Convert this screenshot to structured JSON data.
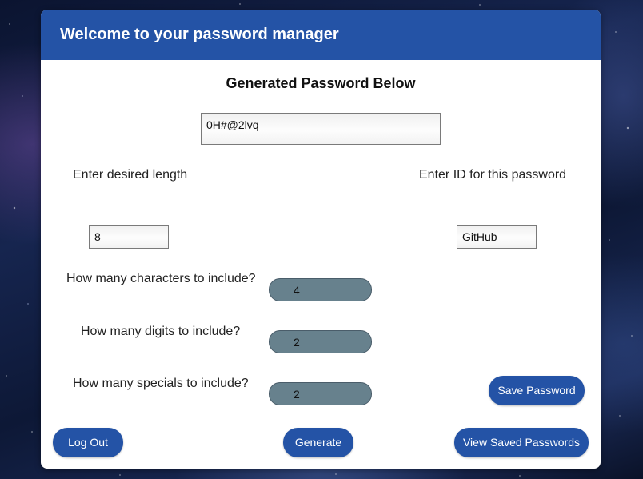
{
  "header": {
    "title": "Welcome to your password manager"
  },
  "generated": {
    "heading": "Generated Password Below",
    "password_value": "0H#@2lvq"
  },
  "length": {
    "label": "Enter desired length",
    "value": "8"
  },
  "password_id": {
    "label": "Enter ID for this password",
    "value": "GitHub"
  },
  "characters": {
    "label": "How many characters to include?",
    "value": "4"
  },
  "digits": {
    "label": "How many digits to include?",
    "value": "2"
  },
  "specials": {
    "label": "How many specials to include?",
    "value": "2"
  },
  "buttons": {
    "save_password": "Save Password",
    "log_out": "Log Out",
    "generate": "Generate",
    "view_saved": "View Saved Passwords"
  },
  "colors": {
    "accent": "#2453a6",
    "spinner": "#67818d"
  }
}
